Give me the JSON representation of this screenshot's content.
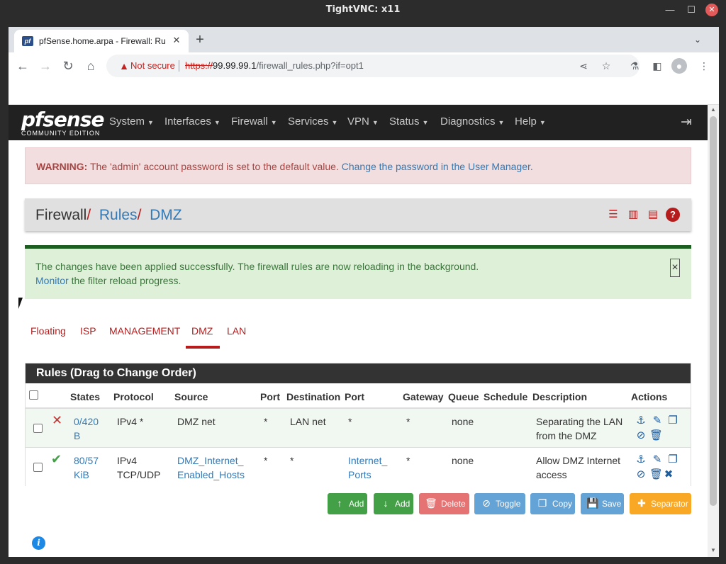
{
  "vnc": {
    "title": "TightVNC: x11"
  },
  "browser": {
    "tab_title": "pfSense.home.arpa - Firewall: Rul",
    "favicon": "pf",
    "security_label": "Not secure",
    "url_scheme": "https://",
    "url_host": "99.99.99.1",
    "url_path": "/firewall_rules.php?if=opt1"
  },
  "nav": {
    "logo_main": "pfsense",
    "logo_sub": "COMMUNITY EDITION",
    "menu": [
      "System",
      "Interfaces",
      "Firewall",
      "Services",
      "VPN",
      "Status",
      "Diagnostics",
      "Help"
    ]
  },
  "warning": {
    "label": "WARNING:",
    "text": " The 'admin' account password is set to the default value. ",
    "link": "Change the password in the User Manager."
  },
  "breadcrumb": {
    "root": "Firewall",
    "sep": "/",
    "level2": "Rules",
    "level3": "DMZ"
  },
  "success": {
    "line1": "The changes have been applied successfully. The firewall rules are now reloading in the background.",
    "link": "Monitor",
    "line2_rest": " the filter reload progress."
  },
  "tabs": [
    "Floating",
    "ISP",
    "MANAGEMENT",
    "DMZ",
    "LAN"
  ],
  "active_tab": "DMZ",
  "table": {
    "heading": "Rules (Drag to Change Order)",
    "columns": [
      "States",
      "Protocol",
      "Source",
      "Port",
      "Destination",
      "Port",
      "Gateway",
      "Queue",
      "Schedule",
      "Description",
      "Actions"
    ],
    "rows": [
      {
        "status": "blocked",
        "states_1": "0/420",
        "states_2": "B",
        "protocol_1": "IPv4 *",
        "protocol_2": "",
        "source_1": "DMZ net",
        "source_2": "",
        "port": "*",
        "destination": "LAN net",
        "dest_port_1": "*",
        "dest_port_2": "",
        "gateway": "*",
        "queue": "none",
        "schedule": "",
        "description_1": "Separating the LAN",
        "description_2": "from the DMZ"
      },
      {
        "status": "pass",
        "states_1": "80/57",
        "states_2": "KiB",
        "protocol_1": "IPv4",
        "protocol_2": "TCP/UDP",
        "source_1": "DMZ_Internet_",
        "source_2": "Enabled_Hosts",
        "port": "*",
        "destination": "*",
        "dest_port_1": "Internet_",
        "dest_port_2": "Ports",
        "gateway": "*",
        "queue": "none",
        "schedule": "",
        "description_1": "Allow DMZ Internet",
        "description_2": "access"
      }
    ]
  },
  "buttons": {
    "add_top": "Add",
    "add_bottom": "Add",
    "delete": "Delete",
    "toggle": "Toggle",
    "copy": "Copy",
    "save": "Save",
    "separator": "Separator"
  },
  "colors": {
    "navbar": "#212121",
    "accent_red": "#b71c1c",
    "link_blue": "#337ab7",
    "success_green": "#43a047",
    "table_header": "#333333"
  }
}
